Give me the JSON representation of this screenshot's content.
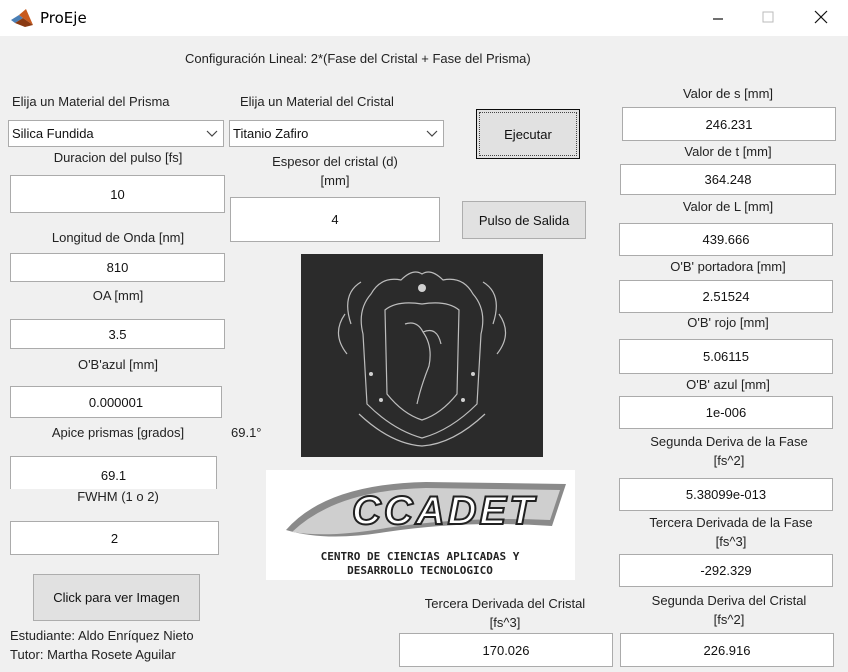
{
  "window": {
    "title": "ProEje"
  },
  "header": {
    "config_text": "Configuración Lineal:  2*(Fase del Cristal + Fase del Prisma)"
  },
  "left": {
    "prism_label": "Elija un Material del Prisma",
    "prism_value": "Silica Fundida",
    "duration_label": "Duracion del pulso [fs]",
    "duration_value": "10",
    "wavelength_label": "Longitud de Onda [nm]",
    "wavelength_value": "810",
    "oa_label": "OA [mm]",
    "oa_value": "3.5",
    "obazul_label": "O'B'azul [mm]",
    "obazul_value": "0.000001",
    "apex_label": "Apice prismas [grados]",
    "apex_display": "69.1°",
    "apex_value": "69.1",
    "fwhm_label": "FWHM (1 o 2)",
    "fwhm_value": "2",
    "view_image_button": "Click para ver Imagen",
    "student": "Estudiante: Aldo Enríquez Nieto",
    "tutor": "Tutor: Martha Rosete Aguilar"
  },
  "middle": {
    "crystal_label": "Elija un Material del Cristal",
    "crystal_value": "Titanio Zafiro",
    "thickness_label_1": "Espesor del cristal (d)",
    "thickness_label_2": "[mm]",
    "thickness_value": "4",
    "execute_button": "Ejecutar",
    "output_pulse_button": "Pulso de Salida",
    "logo_text": "CCADET",
    "logo_subtitle_1": "CENTRO DE CIENCIAS APLICADAS Y",
    "logo_subtitle_2": "DESARROLLO TECNOLOGICO",
    "third_crystal_label_1": "Tercera Derivada del Cristal",
    "third_crystal_label_2": "[fs^3]",
    "third_crystal_value": "170.026"
  },
  "right": {
    "s_label": "Valor de s [mm]",
    "s_value": "246.231",
    "t_label": "Valor de t [mm]",
    "t_value": "364.248",
    "l_label": "Valor de L [mm]",
    "l_value": "439.666",
    "carrier_label": "O'B' portadora [mm]",
    "carrier_value": "2.51524",
    "red_label": "O'B' rojo [mm]",
    "red_value": "5.06115",
    "blue_label": "O'B' azul [mm]",
    "blue_value": "1e-006",
    "second_phase_label_1": "Segunda Deriva de la Fase",
    "second_phase_label_2": "[fs^2]",
    "second_phase_value": "5.38099e-013",
    "third_phase_label_1": "Tercera Derivada de la Fase",
    "third_phase_label_2": "[fs^3]",
    "third_phase_value": "-292.329",
    "second_crystal_label_1": "Segunda Deriva del Cristal",
    "second_crystal_label_2": "[fs^2]",
    "second_crystal_value": "226.916"
  }
}
